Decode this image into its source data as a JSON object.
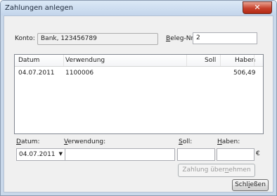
{
  "window": {
    "title": "Zahlungen anlegen",
    "close_glyph": "✕"
  },
  "konto": {
    "label": "Konto:",
    "value": "Bank, 123456789"
  },
  "beleg": {
    "label_underlined": "B",
    "label_rest": "eleg-Nr.:",
    "value": "2"
  },
  "table": {
    "columns": [
      "Datum",
      "Verwendung",
      "Soll",
      "Haben"
    ],
    "rows": [
      {
        "datum": "04.07.2011",
        "verwendung": "1100006",
        "soll": "",
        "haben": "506,49"
      }
    ]
  },
  "entry": {
    "datum_label_u": "D",
    "datum_label_rest": "atum:",
    "verwendung_label_u": "V",
    "verwendung_label_rest": "erwendung:",
    "soll_label_u": "S",
    "soll_label_rest": "oll:",
    "haben_label_u": "H",
    "haben_label_rest": "aben:",
    "datum_value": "04.07.2011",
    "currency": "€"
  },
  "buttons": {
    "zahlung_pre": "Zahlung über",
    "zahlung_u": "n",
    "zahlung_post": "ehmen",
    "schliessen_pre": "Schl",
    "schliessen_u": "i",
    "schliessen_post": "eßen"
  }
}
